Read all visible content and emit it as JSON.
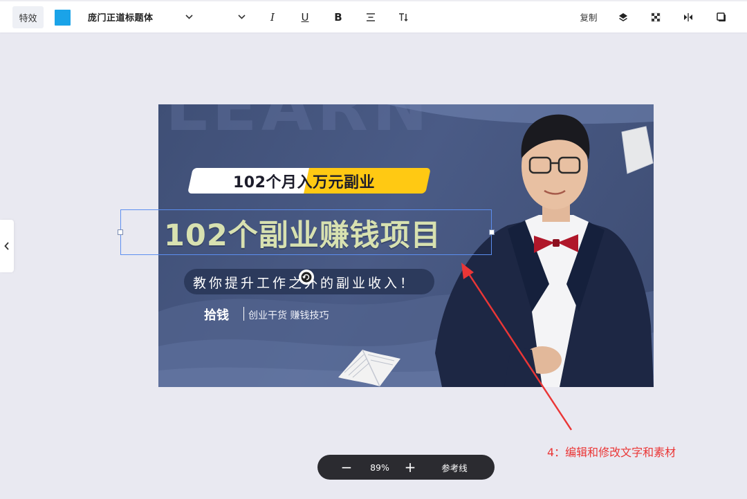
{
  "toolbar": {
    "effect_label": "特效",
    "color": "#1aa3e8",
    "font_name": "庞门正道标题体",
    "font_style_italic": "I",
    "font_style_underline": "U",
    "font_style_bold": "B",
    "copy_label": "复制"
  },
  "canvas": {
    "watermark": "LEARN",
    "pill_title_white": "102个月",
    "pill_title_yellow": "入万元副业",
    "headline": "102个副业赚钱项目",
    "subtitle": "教你提升工作之外的副业收入！",
    "brand": "拾钱",
    "tagline": "创业干货  赚钱技巧"
  },
  "annotation": {
    "text": "4：编辑和修改文字和素材",
    "color": "#ea3636"
  },
  "zoom": {
    "minus": "−",
    "value": "89%",
    "plus": "+",
    "guides_label": "参考线"
  }
}
